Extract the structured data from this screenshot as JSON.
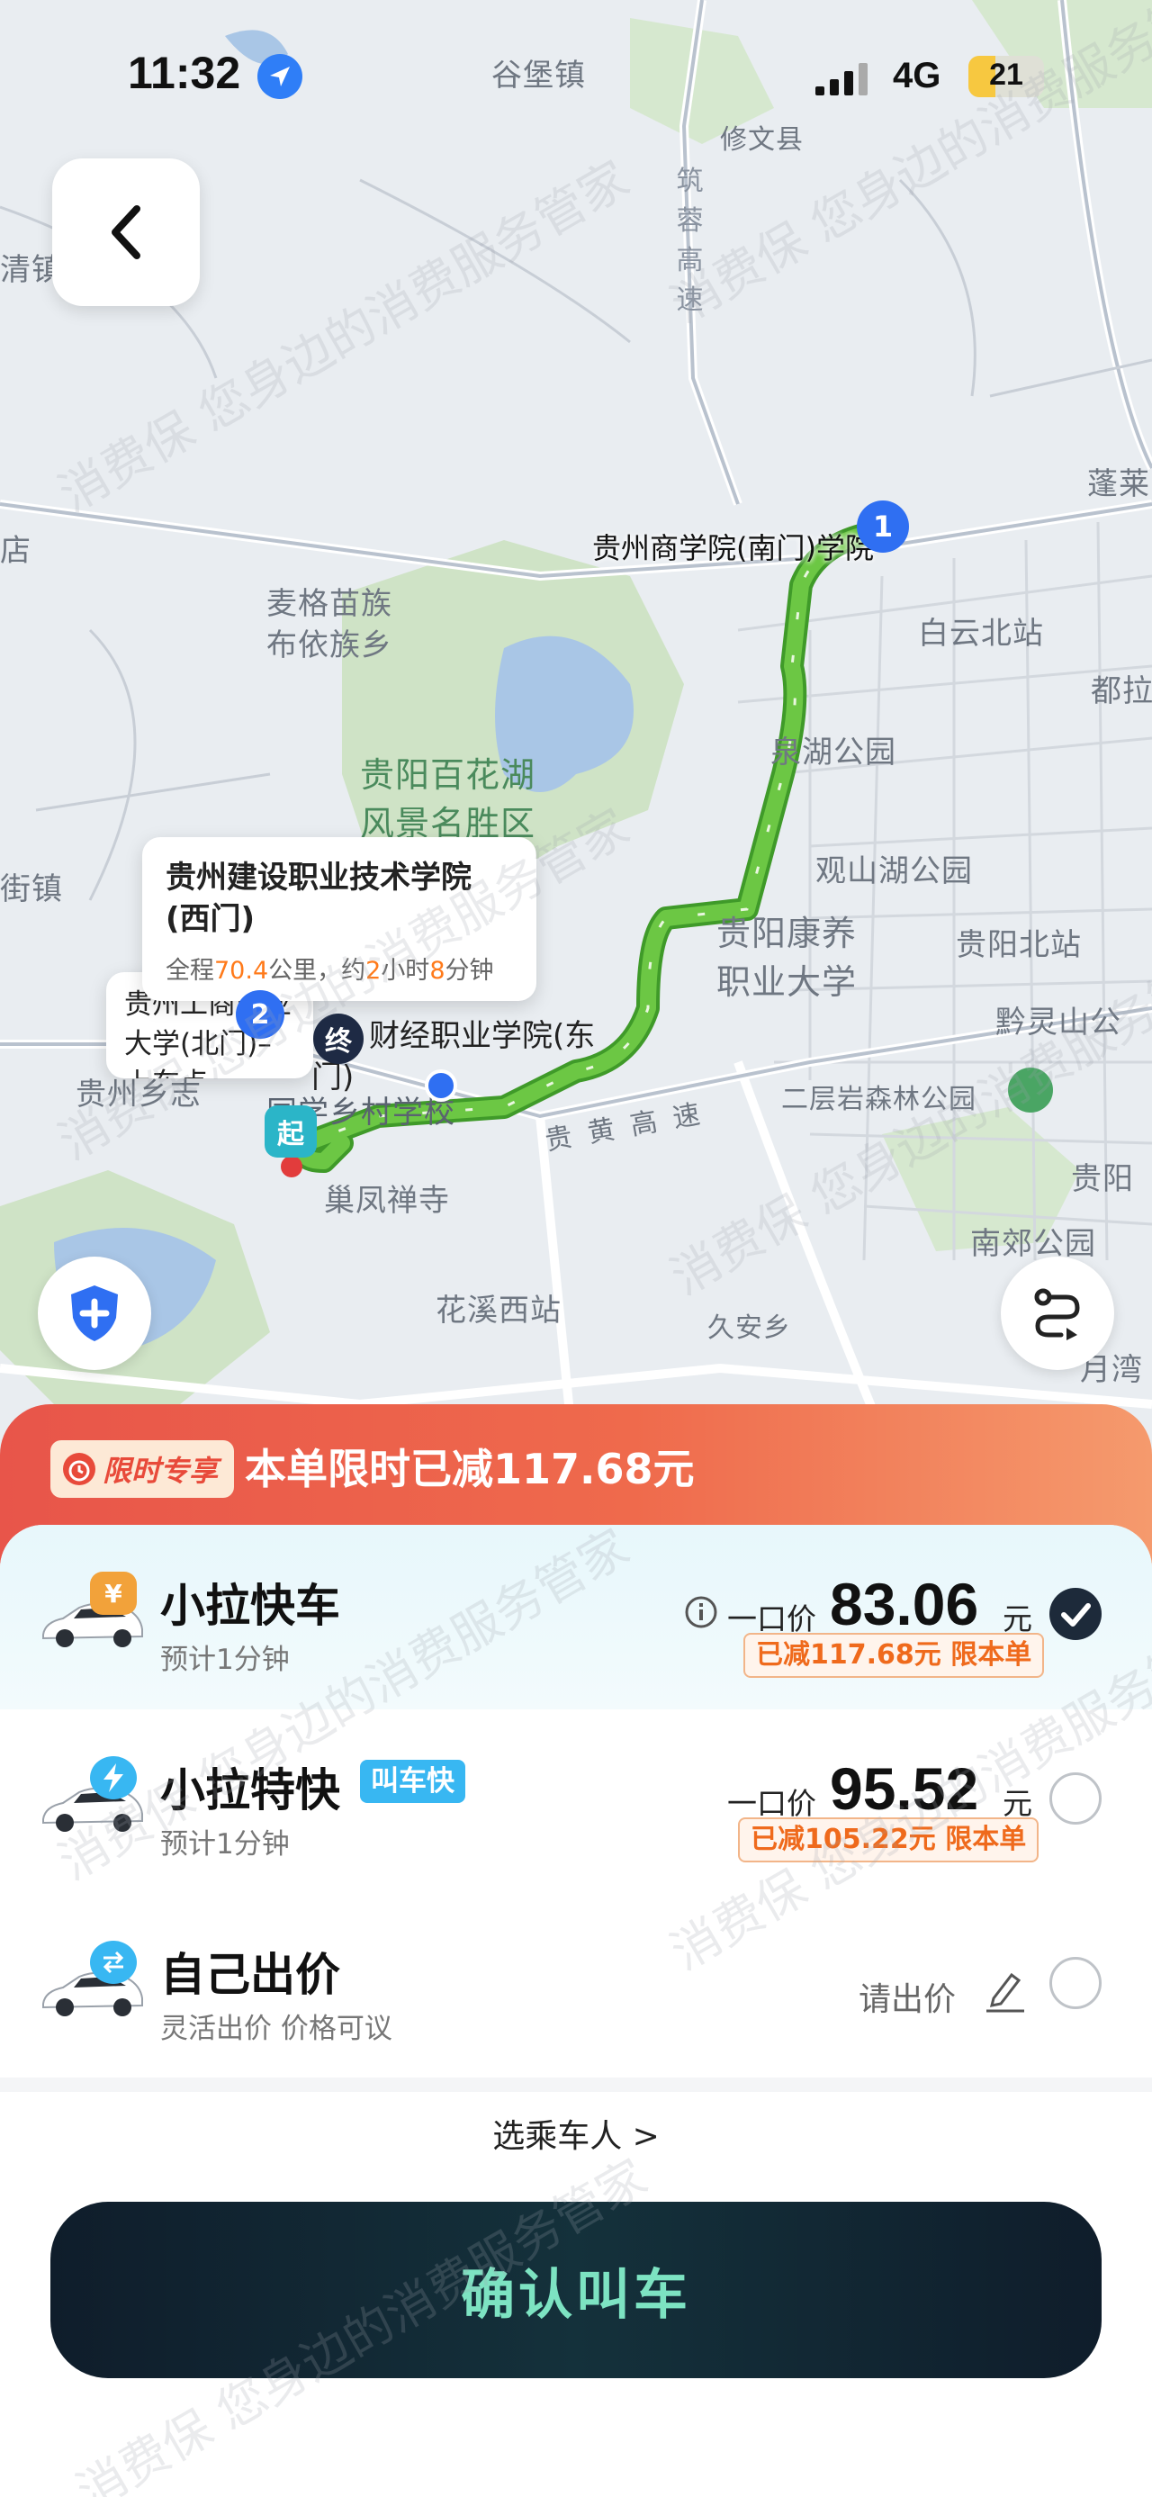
{
  "status_bar": {
    "time": "11:32",
    "network": "4G",
    "battery": "21"
  },
  "map": {
    "labels": {
      "gubao": "谷堡镇",
      "xiuwen": "修文县",
      "zhuhai_expressway": "筑蓉高速",
      "qingzhen": "清镇",
      "penglai": "蓬莱",
      "dian": "店",
      "maige": "麦格苗族\n布依族乡",
      "baiyun_north": "白云北站",
      "dula": "都拉",
      "quanhu": "泉湖公园",
      "baihuahu": "贵阳百花湖\n风景名胜区",
      "guanshanhu": "观山湖公园",
      "kangyang": "贵阳康养\n职业大学",
      "guiyang_north": "贵阳北站",
      "qianlingshan": "黔灵山公",
      "er_ceng_yan": "二层岩森林公园",
      "guiyang_e": "贵阳",
      "nanjiao": "南郊公园",
      "fuhuang": "巢凤禅寺",
      "huaxi_west": "花溪西站",
      "jiuan": "久安乡",
      "huaxi_bay": "月湾",
      "gui_huang": "贵黄高速",
      "guizhou_zhi": "贵州乡志",
      "x_school": "同学乡村学校",
      "ting": "街镇"
    },
    "start_label_top": "贵州商学院(南门)",
    "start_label_suffix": "学院",
    "marker_1": "1",
    "marker_2": "2",
    "marker_end": "终",
    "marker_start": "起",
    "popup_dest": {
      "title": "贵州建设职业技术学院(西门)",
      "info_prefix": "全程",
      "distance": "70.4",
      "info_mid1": "公里，约",
      "hours": "2",
      "info_mid2": "小时",
      "minutes": "8",
      "info_suffix": "分钟"
    },
    "popup_pickup": "贵州工商职业大学(北门)–上车点",
    "dest_east_label": "财经职业学院(东门)"
  },
  "promo": {
    "badge": "限时专享",
    "text": "本单限时已减117.68元"
  },
  "options": [
    {
      "name": "小拉快车",
      "badge_icon": "¥",
      "subtitle": "预计1分钟",
      "price_prefix": "一口价",
      "price": "83.06",
      "unit": "元",
      "discount": "已减117.68元 限本单",
      "selected": true
    },
    {
      "name": "小拉特快",
      "tag": "叫车快",
      "subtitle": "预计1分钟",
      "price_prefix": "一口价",
      "price": "95.52",
      "unit": "元",
      "discount": "已减105.22元 限本单",
      "selected": false
    },
    {
      "name": "自己出价",
      "subtitle": "灵活出价 价格可议",
      "bid_text": "请出价",
      "selected": false
    }
  ],
  "passenger": "选乘车人 >",
  "confirm_button": "确认叫车",
  "watermark": "消费保 您身边的消费服务管家",
  "colors": {
    "route": "#5bbd3a",
    "primary_blue": "#2f6ff2",
    "promo_red": "#e8554a",
    "discount_orange": "#ef6a1c",
    "confirm_bg": "#0f1d2b",
    "confirm_text": "#7de3c2"
  }
}
